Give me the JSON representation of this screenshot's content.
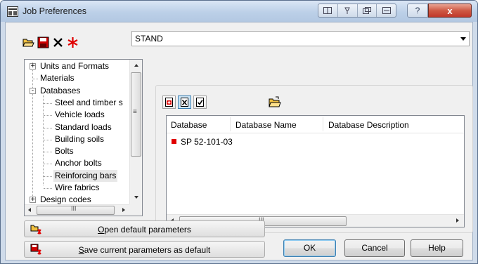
{
  "window": {
    "title": "Job Preferences",
    "help_glyph": "?",
    "close_glyph": "x"
  },
  "toolbar": {
    "icons": [
      "open-folder-icon",
      "save-icon",
      "delete-icon",
      "reset-icon"
    ],
    "profile_value": "STAND"
  },
  "tree": {
    "items": [
      {
        "label": "Units and Formats",
        "expander": "+",
        "level": 0
      },
      {
        "label": "Materials",
        "expander": "",
        "level": 0
      },
      {
        "label": "Databases",
        "expander": "-",
        "level": 0
      },
      {
        "label": "Steel and timber s",
        "expander": "",
        "level": 1
      },
      {
        "label": "Vehicle loads",
        "expander": "",
        "level": 1
      },
      {
        "label": "Standard loads",
        "expander": "",
        "level": 1
      },
      {
        "label": "Building soils",
        "expander": "",
        "level": 1
      },
      {
        "label": "Bolts",
        "expander": "",
        "level": 1
      },
      {
        "label": "Anchor bolts",
        "expander": "",
        "level": 1
      },
      {
        "label": "Reinforcing bars",
        "expander": "",
        "level": 1
      },
      {
        "label": "Wire fabrics",
        "expander": "",
        "level": 1
      },
      {
        "label": "Design codes",
        "expander": "+",
        "level": 0
      }
    ],
    "selected": "Reinforcing bars",
    "hscroll_mid": "III",
    "vscroll_mid": "≡"
  },
  "database": {
    "columns": [
      "Database",
      "Database Name",
      "Database Description"
    ],
    "rows": [
      {
        "database": "SP 52-101-03",
        "name": "",
        "description": ""
      }
    ],
    "hscroll_mid": "III"
  },
  "buttons": {
    "open_default_underline": "O",
    "open_default_rest": "pen default parameters",
    "save_default_underline": "S",
    "save_default_rest": "ave current parameters as default",
    "ok": "OK",
    "cancel": "Cancel",
    "help": "Help"
  },
  "colors": {
    "accent_red": "#e00000",
    "title_gradient_top": "#dae6f5",
    "close_red": "#c0392b"
  }
}
